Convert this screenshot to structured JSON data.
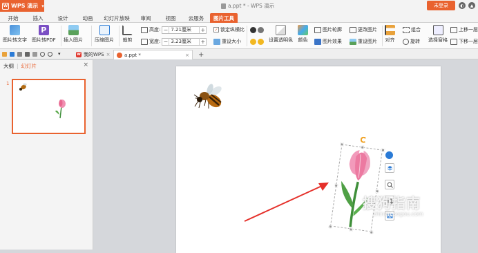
{
  "titlebar": {
    "app_name": "WPS 演示",
    "logo": "W",
    "document_title": "a.ppt * - WPS 演示",
    "login_label": "未登录",
    "colors": {
      "accent": "#e9622f"
    }
  },
  "tabs": [
    "开始",
    "插入",
    "设计",
    "动画",
    "幻灯片放映",
    "审阅",
    "视图",
    "云服务",
    "图片工具"
  ],
  "active_tab": "图片工具",
  "ribbon": {
    "img_to_text": "图片转文字",
    "img_to_pdf": "图片转PDF",
    "insert_image": "插入图片",
    "compress_image": "压缩图片",
    "crop": "裁剪",
    "height_label": "高度:",
    "height_value": "7.21厘米",
    "width_label": "宽度:",
    "width_value": "3.23厘米",
    "lock_ratio": "锁定纵横比",
    "reset_size": "重设大小",
    "set_transparent": "设置透明色",
    "color": "颜色",
    "outline": "图片轮廓",
    "effects": "图片效果",
    "change_image": "更改图片",
    "reset_image": "重设图片",
    "align": "对齐",
    "group": "组合",
    "rotate": "旋转",
    "selection_pane": "选择窗格",
    "bring_forward": "上移一层",
    "send_backward": "下移一层"
  },
  "doc_tabs": {
    "my_wps": "我的WPS",
    "file": "a.ppt *",
    "add": "+"
  },
  "left_panel": {
    "tab_outline": "大纲",
    "tab_slides": "幻灯片",
    "slide_number": "1"
  },
  "watermark": {
    "text": "搜狗指南",
    "url": "zhinan.sogou.com"
  }
}
